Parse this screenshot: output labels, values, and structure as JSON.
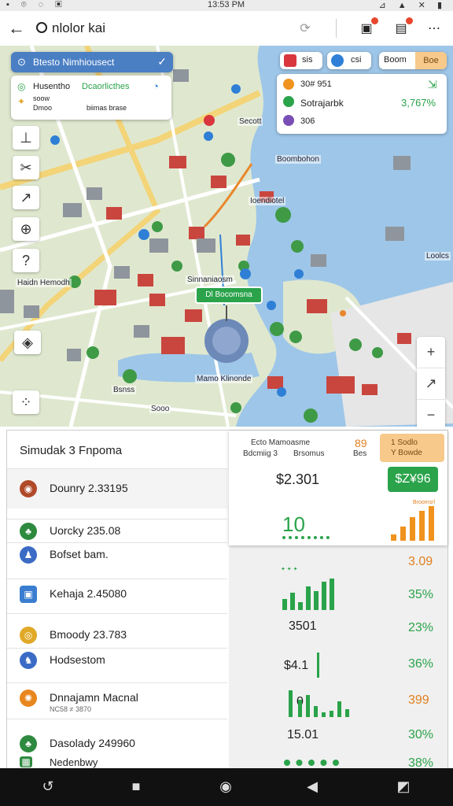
{
  "status_bar": {
    "time": "13:53 PM",
    "left_icons": "▪ ⌾ ◌ ▣",
    "right_icons": "⊿ ▲ ✕ ▮"
  },
  "app_bar": {
    "back_icon": "←",
    "title": "nlolor kai",
    "icons": [
      "refresh-icon",
      "calendar-icon",
      "notifications-icon",
      "more-icon"
    ]
  },
  "map": {
    "search_card": {
      "label": "Btesto Nimhiousect"
    },
    "info_card": {
      "title": "Husentho",
      "subtitle": "Dcaorlicthes",
      "line2": "soow",
      "line3a": "Dmoo",
      "line3b": "biimas brase"
    },
    "chips": [
      {
        "label": "sis",
        "color": "#d9363e"
      },
      {
        "label": "csi",
        "color": "#2f7fd6"
      }
    ],
    "toggle_tabs": [
      "Boom",
      "Boe"
    ],
    "stats_card": {
      "rows": [
        {
          "label": "30# 951",
          "value": "",
          "icon_color": "#f0931e"
        },
        {
          "label": "Sotrajarbk",
          "value": "3,767%",
          "icon_color": "#2aa34a"
        },
        {
          "label": "306",
          "value": "",
          "icon_color": "#7a4fb5"
        }
      ]
    },
    "place_labels": [
      "Secott",
      "Boombohon",
      "Ioendiotel",
      "Haidn Hemodh",
      "Sinnaniaosm",
      "Mamo Klinonde",
      "Sooo",
      "Bsnss"
    ],
    "route_label": "Dl Bocomsna",
    "right_labels": [
      "Loolcs"
    ],
    "zoom_controls": [
      "+",
      "↗",
      "−",
      "↕"
    ]
  },
  "panel": {
    "left_header": "Simudak 3 Fnpoma",
    "rows": [
      {
        "icon": "◉",
        "color": "#b04a2a",
        "text": "Dounry 2.33195",
        "sub": ""
      },
      {
        "icon": "♣",
        "color": "#2d8a3e",
        "text": "Uorcky 235.08",
        "sub": ""
      },
      {
        "icon": "♟",
        "color": "#3b6bc5",
        "text": "Bofset bam.",
        "sub": ""
      },
      {
        "icon": "▣",
        "color": "#3a7dd0",
        "text": "Kehaja 2.45080",
        "sub": ""
      },
      {
        "icon": "◎",
        "color": "#e0a928",
        "text": "Bmoody 23.783",
        "sub": ""
      },
      {
        "icon": "♞",
        "color": "#3b6bc5",
        "text": "Hodsestom",
        "sub": ""
      },
      {
        "icon": "✺",
        "color": "#e8871e",
        "text": "Dnnajamn Macnal",
        "sub": "NC58 ≠ 3870"
      },
      {
        "icon": "♣",
        "color": "#2d8a3e",
        "text": "Dasolady 249960",
        "sub": ""
      },
      {
        "icon": "▦",
        "color": "#2d8a3e",
        "text": "Nedenbwy",
        "sub": ""
      }
    ],
    "right": {
      "headers": [
        "Ecto Mamoasme",
        "Bdcmiig 3",
        "Brsomus",
        "89",
        "Bes"
      ],
      "highlight_header": [
        "1 Sodlo",
        "Y Bowde"
      ],
      "top_value": "$2.301",
      "green_badge": "$Z¥96",
      "big_value": "10",
      "bar_label": "Broomsrl",
      "cells": [
        {
          "value": "",
          "pct": "3.09",
          "pct_color": "#e0801e"
        },
        {
          "value": "",
          "pct": "35%",
          "pct_color": "#2aa34a"
        },
        {
          "value": "3501",
          "pct": "23%",
          "pct_color": "#2aa34a"
        },
        {
          "value": "$4.1",
          "pct": "36%",
          "pct_color": "#2aa34a"
        },
        {
          "value": "0",
          "pct": "399",
          "pct_color": "#e0801e"
        },
        {
          "value": "15.01",
          "pct": "30%",
          "pct_color": "#2aa34a"
        },
        {
          "value": "",
          "pct": "38%",
          "pct_color": "#2aa34a"
        }
      ],
      "colors": {
        "accent_green": "#2aa34a",
        "accent_orange": "#f0931e"
      }
    }
  },
  "nav_bar": {
    "icons": [
      "back-icon",
      "home-square-icon",
      "home-circle-icon",
      "back-triangle-icon",
      "recents-icon"
    ]
  }
}
